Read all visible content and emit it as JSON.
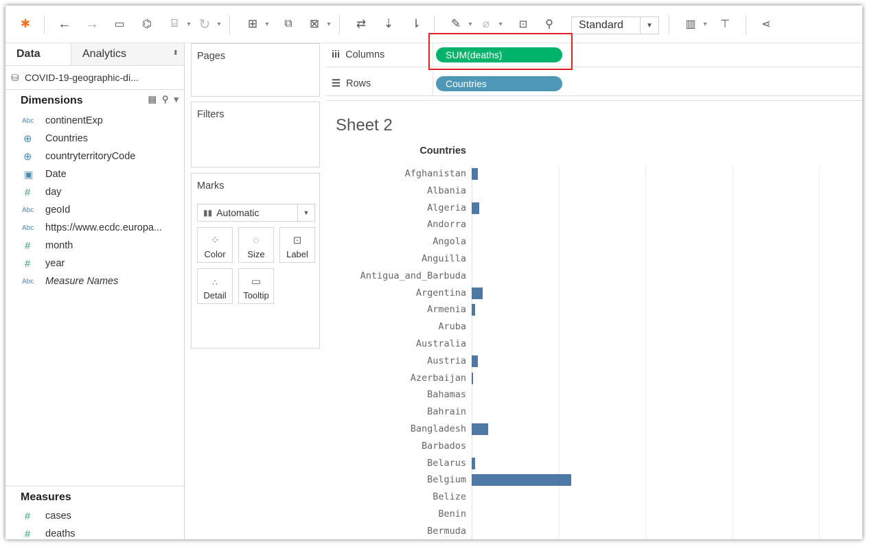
{
  "toolbar": {
    "icons": [
      "tableau-logo-icon",
      "back-arrow-icon",
      "forward-arrow-icon",
      "save-icon",
      "new-datasource-icon",
      "pause-updates-icon",
      "refresh-icon",
      "new-worksheet-icon",
      "duplicate-sheet-icon",
      "clear-sheet-icon",
      "swap-axes-icon",
      "sort-ascending-icon",
      "sort-descending-icon",
      "highlight-icon",
      "group-icon",
      "show-labels-icon",
      "pin-icon",
      "show-me-icon",
      "presentation-icon",
      "share-icon"
    ],
    "fit_value": "Standard"
  },
  "left": {
    "tab_data": "Data",
    "tab_analytics": "Analytics",
    "datasource": "COVID-19-geographic-di...",
    "dimensions_title": "Dimensions",
    "dimensions": [
      {
        "type": "Abc",
        "icon": "string-type-icon",
        "label": "continentExp",
        "italic": false
      },
      {
        "type": "geo",
        "icon": "globe-icon",
        "label": "Countries",
        "italic": false
      },
      {
        "type": "geo",
        "icon": "globe-icon",
        "label": "countryterritoryCode",
        "italic": false
      },
      {
        "type": "date",
        "icon": "calendar-icon",
        "label": "Date",
        "italic": false
      },
      {
        "type": "#",
        "icon": "number-type-icon",
        "label": "day",
        "italic": false
      },
      {
        "type": "Abc",
        "icon": "string-type-icon",
        "label": "geoId",
        "italic": false
      },
      {
        "type": "Abc",
        "icon": "string-type-icon",
        "label": "https://www.ecdc.europa...",
        "italic": false
      },
      {
        "type": "#",
        "icon": "number-type-icon",
        "label": "month",
        "italic": false
      },
      {
        "type": "#",
        "icon": "number-type-icon",
        "label": "year",
        "italic": false
      },
      {
        "type": "Abc",
        "icon": "string-type-icon",
        "label": "Measure Names",
        "italic": true
      }
    ],
    "measures_title": "Measures",
    "measures": [
      {
        "type": "#",
        "icon": "number-type-icon",
        "label": "cases"
      },
      {
        "type": "#",
        "icon": "number-type-icon",
        "label": "deaths"
      }
    ]
  },
  "cards": {
    "pages": "Pages",
    "filters": "Filters",
    "marks": "Marks",
    "mark_type": "Automatic",
    "mark_buttons": [
      {
        "label": "Color",
        "icon": "color-dots-icon"
      },
      {
        "label": "Size",
        "icon": "size-icon"
      },
      {
        "label": "Label",
        "icon": "label-icon"
      },
      {
        "label": "Detail",
        "icon": "detail-icon"
      },
      {
        "label": "Tooltip",
        "icon": "tooltip-icon"
      }
    ]
  },
  "shelves": {
    "columns_label": "Columns",
    "columns_pill": "SUM(deaths)",
    "rows_label": "Rows",
    "rows_pill": "Countries"
  },
  "view": {
    "sheet_title": "Sheet 2"
  },
  "colors": {
    "bar": "#4e79a7",
    "measure_pill": "#00b36b",
    "dimension_pill": "#4e97b6",
    "highlight_box": "#e21f26"
  },
  "chart_data": {
    "type": "bar",
    "orientation": "horizontal",
    "title": "Sheet 2",
    "row_header": "Countries",
    "xlabel": "",
    "categories": [
      "Afghanistan",
      "Albania",
      "Algeria",
      "Andorra",
      "Angola",
      "Anguilla",
      "Antigua_and_Barbuda",
      "Argentina",
      "Armenia",
      "Aruba",
      "Australia",
      "Austria",
      "Azerbaijan",
      "Bahamas",
      "Bahrain",
      "Bangladesh",
      "Barbados",
      "Belarus",
      "Belgium",
      "Belize",
      "Benin",
      "Bermuda"
    ],
    "values": [
      1200,
      0,
      1400,
      0,
      0,
      0,
      0,
      2000,
      600,
      0,
      0,
      1100,
      200,
      0,
      0,
      3000,
      0,
      600,
      18500,
      0,
      0,
      0
    ],
    "xlim": [
      0,
      84000
    ],
    "grid": true
  }
}
